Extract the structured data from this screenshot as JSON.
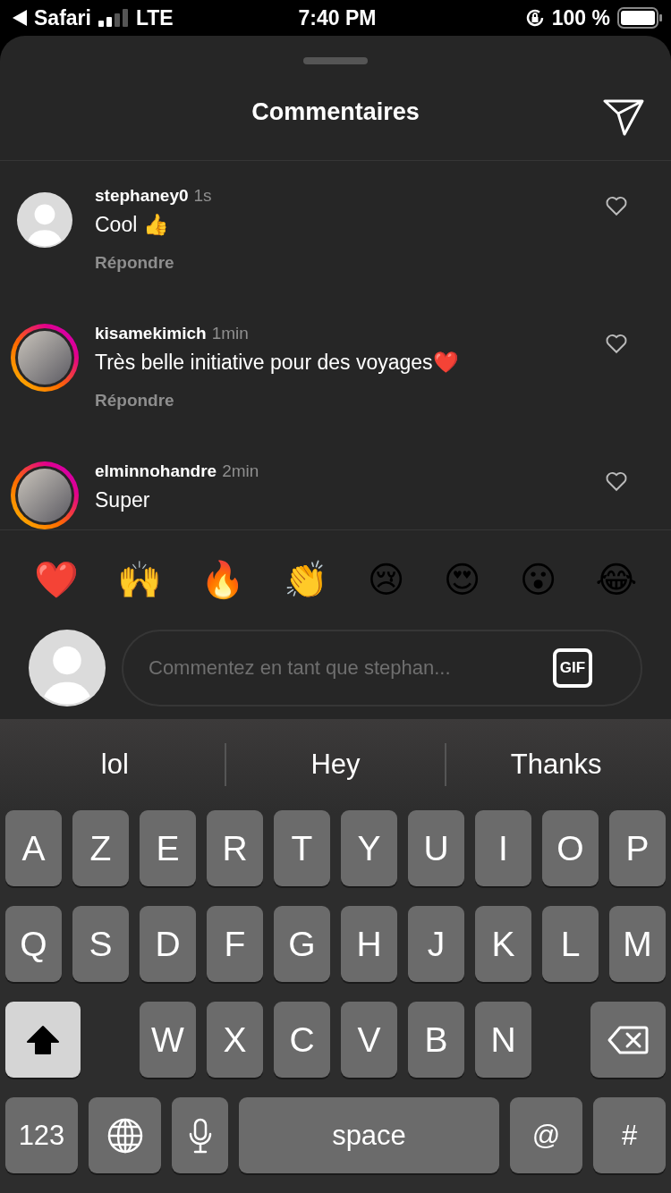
{
  "status_bar": {
    "back_app": "Safari",
    "network": "LTE",
    "time": "7:40 PM",
    "battery": "100 %"
  },
  "header": {
    "title": "Commentaires"
  },
  "comments": [
    {
      "username": "stephaney0",
      "time": "1s",
      "text": "Cool 👍",
      "reply": "Répondre",
      "story_ring": false,
      "liked": false
    },
    {
      "username": "kisamekimich",
      "time": "1min",
      "text": "Très belle initiative pour des voyages❤️",
      "reply": "Répondre",
      "story_ring": true,
      "liked": false
    },
    {
      "username": "elminnohandre",
      "time": "2min",
      "text": "Super",
      "story_ring": true,
      "liked": false
    }
  ],
  "reactions": [
    "❤️",
    "🙌",
    "🔥",
    "👏",
    "😢",
    "😍",
    "😮",
    "😂"
  ],
  "composer": {
    "placeholder": "Commentez en tant que stephan...",
    "gif": "GIF"
  },
  "keyboard": {
    "suggestions": [
      "lol",
      "Hey",
      "Thanks"
    ],
    "top_letters": [
      "A",
      "Z",
      "E",
      "R",
      "T",
      "Y",
      "U",
      "I",
      "O",
      "P"
    ],
    "home_letters": [
      "Q",
      "S",
      "D",
      "F",
      "G",
      "H",
      "J",
      "K",
      "L",
      "M"
    ],
    "shift_row": {
      "shift_on": true,
      "letters": [
        "W",
        "X",
        "C",
        "V",
        "B",
        "N"
      ]
    },
    "bottom_keys": [
      {
        "kind": "wide",
        "label": "123"
      },
      {
        "kind": "globe"
      },
      {
        "kind": "mic"
      },
      {
        "kind": "space",
        "label": "space"
      },
      {
        "kind": "wide",
        "label": "@"
      },
      {
        "kind": "wide",
        "label": "#"
      }
    ]
  }
}
